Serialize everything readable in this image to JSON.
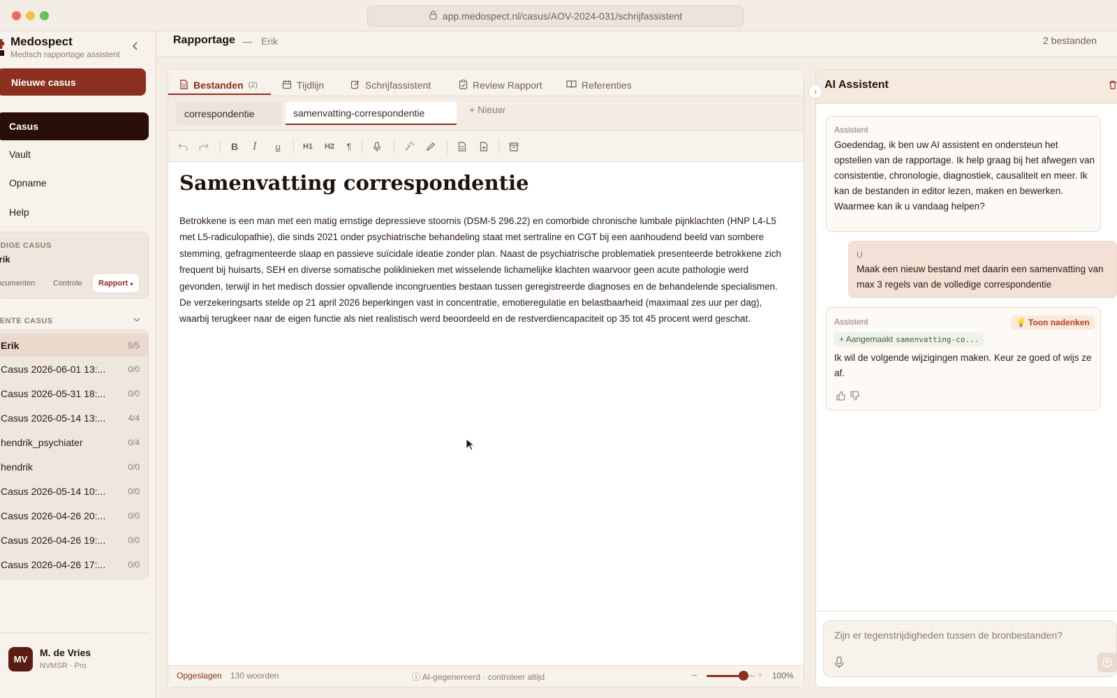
{
  "browser": {
    "url": "app.medospect.nl/casus/AOV-2024-031/schrijfassistent"
  },
  "colors": {
    "accent": "#8b2f1f",
    "dark": "#2a0e08",
    "background": "#f4ede4"
  },
  "sidebar": {
    "app_name": "Medospect",
    "app_subtitle": "Medisch rapportage assistent",
    "new_case_label": "Nieuwe casus",
    "nav": [
      {
        "label": "Casus",
        "active": true
      },
      {
        "label": "Vault",
        "active": false
      },
      {
        "label": "Opname",
        "active": false
      },
      {
        "label": "Help",
        "active": false
      }
    ],
    "current_case": {
      "heading": "HUIDIGE CASUS",
      "name": "Erik",
      "segments": [
        "Documenten",
        "Controle",
        "Rapport"
      ],
      "active_segment": "Rapport"
    },
    "recent": {
      "heading": "RECENTE CASUS",
      "items": [
        {
          "name": "Erik",
          "count": "5/5",
          "active": true
        },
        {
          "name": "Casus 2026-06-01 13:...",
          "count": "0/0"
        },
        {
          "name": "Casus 2026-05-31 18:...",
          "count": "0/0"
        },
        {
          "name": "Casus 2026-05-14 13:...",
          "count": "4/4"
        },
        {
          "name": "hendrik_psychiater",
          "count": "0/4"
        },
        {
          "name": "hendrik",
          "count": "0/0"
        },
        {
          "name": "Casus 2026-05-14 10:...",
          "count": "0/0"
        },
        {
          "name": "Casus 2026-04-26 20:...",
          "count": "0/0"
        },
        {
          "name": "Casus 2026-04-26 19:...",
          "count": "0/0"
        },
        {
          "name": "Casus 2026-04-26 17:...",
          "count": "0/0"
        }
      ]
    },
    "user": {
      "initials": "MV",
      "name": "M. de Vries",
      "role": "NVMSR · Pro"
    }
  },
  "topbar": {
    "title": "Rapportage",
    "separator": "—",
    "case_name": "Erik",
    "files": "2 bestanden"
  },
  "tabs": [
    {
      "label": "Bestanden",
      "badge": "(2)",
      "active": true,
      "icon": "file-icon"
    },
    {
      "label": "Tijdlijn",
      "icon": "calendar-icon"
    },
    {
      "label": "Schrijfassistent",
      "icon": "edit-icon"
    },
    {
      "label": "Review Rapport",
      "icon": "clipboard-icon"
    },
    {
      "label": "Referenties",
      "icon": "book-icon"
    }
  ],
  "file_tabs": [
    {
      "label": "correspondentie",
      "active": false
    },
    {
      "label": "samenvatting-correspondentie",
      "active": true
    }
  ],
  "new_file_label": "Nieuw",
  "toolbar": {
    "h1": "H1",
    "h2": "H2"
  },
  "document": {
    "title": "Samenvatting correspondentie",
    "body": "Betrokkene is een man met een matig ernstige depressieve stoornis (DSM-5 296.22) en comorbide chronische lumbale pijnklachten (HNP L4-L5 met L5-radiculopathie), die sinds 2021 onder psychiatrische behandeling staat met sertraline en CGT bij een aanhoudend beeld van sombere stemming, gefragmenteerde slaap en passieve suïcidale ideatie zonder plan. Naast de psychiatrische problematiek presenteerde betrokkene zich frequent bij huisarts, SEH en diverse somatische poliklinieken met wisselende lichamelijke klachten waarvoor geen acute pathologie werd gevonden, terwijl in het medisch dossier opvallende incongruenties bestaan tussen geregistreerde diagnoses en de behandelende specialismen. De verzekeringsarts stelde op 21 april 2026 beperkingen vast in concentratie, emotieregulatie en belastbaarheid (maximaal zes uur per dag), waarbij terugkeer naar de eigen functie als niet realistisch werd beoordeeld en de restverdiencapaciteit op 35 tot 45 procent werd geschat."
  },
  "statusbar": {
    "saved": "Opgeslagen",
    "words": "130 woorden",
    "ai_notice": "AI-gegenereerd · controleer altijd",
    "zoom_minus": "–",
    "zoom_plus": "+",
    "zoom": "100%",
    "zoom_level": 0.75
  },
  "assistant": {
    "title": "AI Assistent",
    "messages": [
      {
        "role": "Assistent",
        "text": "Goedendag, ik ben uw AI assistent en ondersteun het opstellen van de rapportage. Ik help graag bij het afwegen van consistentie, chronologie, diagnostiek, causaliteit en meer. Ik kan de bestanden in editor lezen, maken en bewerken. Waarmee kan ik u vandaag helpen?"
      },
      {
        "role": "U",
        "text": "Maak een nieuw bestand met daarin een samenvatting van max 3 regels van de volledige correspondentie"
      },
      {
        "role": "Assistent",
        "text": "Ik wil de volgende wijzigingen maken. Keur ze goed of wijs ze af.",
        "thinking_label": "Toon nadenken",
        "created_prefix": "+ Aangemaakt",
        "created_file": "samenvatting-co..."
      }
    ],
    "input_placeholder": "Zijn er tegenstrijdigheden tussen de bronbestanden?"
  }
}
